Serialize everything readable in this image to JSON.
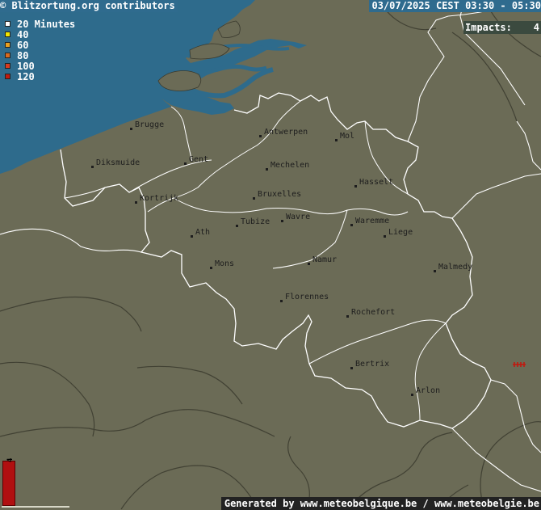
{
  "header": {
    "copyright": "© Blitzortung.org contributors",
    "datetime": "03/07/2025 CEST 03:30 - 05:30",
    "impacts_label": "Impacts:",
    "impacts_value": "4"
  },
  "legend": [
    {
      "label": "20 Minutes",
      "color": "#ffffff"
    },
    {
      "label": "40",
      "color": "#f2e600"
    },
    {
      "label": "60",
      "color": "#e8a020"
    },
    {
      "label": "80",
      "color": "#d86a20"
    },
    {
      "label": "100",
      "color": "#d83a20"
    },
    {
      "label": "120",
      "color": "#c01a10"
    }
  ],
  "cities": [
    {
      "name": "Brugge"
    },
    {
      "name": "Antwerpen"
    },
    {
      "name": "Mol"
    },
    {
      "name": "Diksmuide"
    },
    {
      "name": "Gent"
    },
    {
      "name": "Mechelen"
    },
    {
      "name": "Hasselt"
    },
    {
      "name": "Kortrijk"
    },
    {
      "name": "Bruxelles"
    },
    {
      "name": "Tubize"
    },
    {
      "name": "Wavre"
    },
    {
      "name": "Waremme"
    },
    {
      "name": "Liege"
    },
    {
      "name": "Ath"
    },
    {
      "name": "Mons"
    },
    {
      "name": "Namur"
    },
    {
      "name": "Malmedy"
    },
    {
      "name": "Florennes"
    },
    {
      "name": "Rochefort"
    },
    {
      "name": "Bertrix"
    },
    {
      "name": "Arlon"
    }
  ],
  "strikes": {
    "count": 4,
    "color": "#c01a10"
  },
  "histogram": {
    "count": "4",
    "bar_color": "#b01010"
  },
  "footer": {
    "text": "Generated by www.meteobelgique.be / www.meteobelgie.be"
  },
  "colors": {
    "land": "#6b6b56",
    "sea": "#2e6b8c",
    "border": "#ffffff",
    "region": "#3a3a2e"
  }
}
